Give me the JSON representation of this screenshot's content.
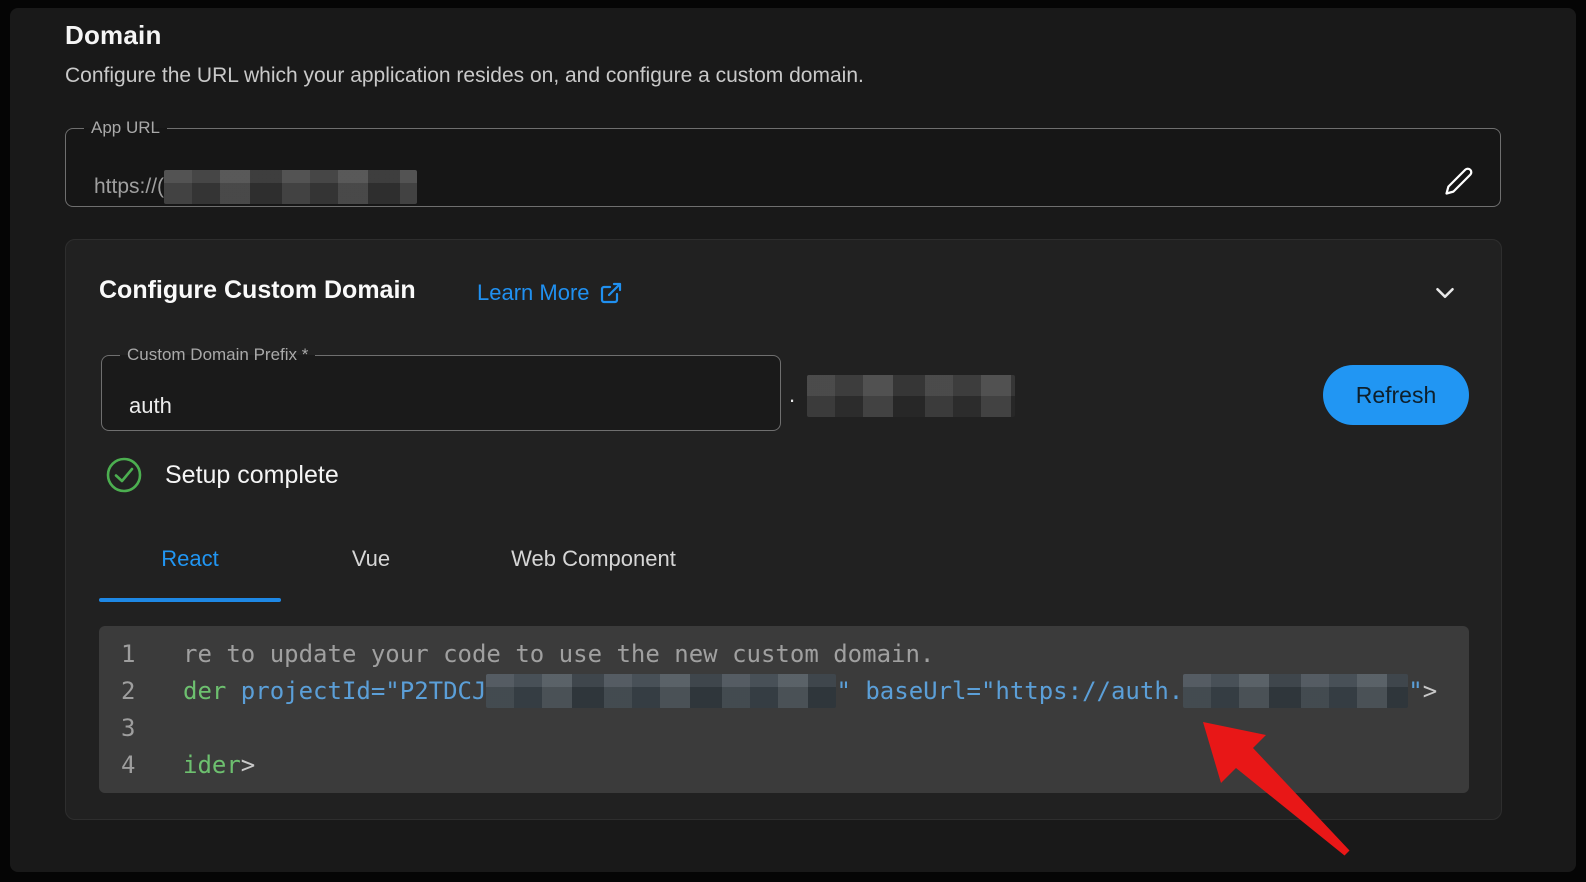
{
  "page": {
    "title": "Domain",
    "subtitle": "Configure the URL which your application resides on, and configure a custom domain."
  },
  "app_url": {
    "label": "App URL",
    "value_visible": "https://(",
    "value_redacted": true
  },
  "custom_domain": {
    "title": "Configure Custom Domain",
    "learn_more_label": "Learn More",
    "prefix_label": "Custom Domain Prefix *",
    "prefix_value": "auth",
    "suffix_separator": ".",
    "suffix_redacted": true,
    "refresh_label": "Refresh",
    "status_text": "Setup complete"
  },
  "tabs": [
    {
      "label": "React",
      "active": true
    },
    {
      "label": "Vue",
      "active": false
    },
    {
      "label": "Web Component",
      "active": false
    }
  ],
  "code": {
    "lines": [
      {
        "number": "1",
        "tokens": [
          {
            "t": "re to update your code to use the new custom domain.",
            "c": "comment"
          }
        ]
      },
      {
        "number": "2",
        "tokens": [
          {
            "t": "der ",
            "c": "tag"
          },
          {
            "t": "projectId=\"P2TDCJ",
            "c": "attr"
          },
          {
            "blur": 350
          },
          {
            "t": "\" ",
            "c": "attr"
          },
          {
            "t": "baseUrl=\"https://auth.",
            "c": "attr"
          },
          {
            "blur": 225
          },
          {
            "t": "\"",
            "c": "attr"
          },
          {
            "t": ">",
            "c": "plain"
          }
        ]
      },
      {
        "number": "3",
        "tokens": []
      },
      {
        "number": "4",
        "tokens": [
          {
            "t": "ider",
            "c": "tag"
          },
          {
            "t": ">",
            "c": "plain"
          }
        ]
      }
    ]
  },
  "annotation": {
    "type": "red-arrow",
    "color": "#e81717",
    "points_at": "baseUrl custom domain value"
  },
  "colors": {
    "accent_blue": "#2196f3",
    "link_blue": "#2090f0",
    "underline_blue": "#1e88e5",
    "success_green": "#4caf50",
    "page_bg": "#191919",
    "panel_bg": "#212121",
    "code_bg": "#3b3b3b",
    "arrow_red": "#e81717"
  }
}
